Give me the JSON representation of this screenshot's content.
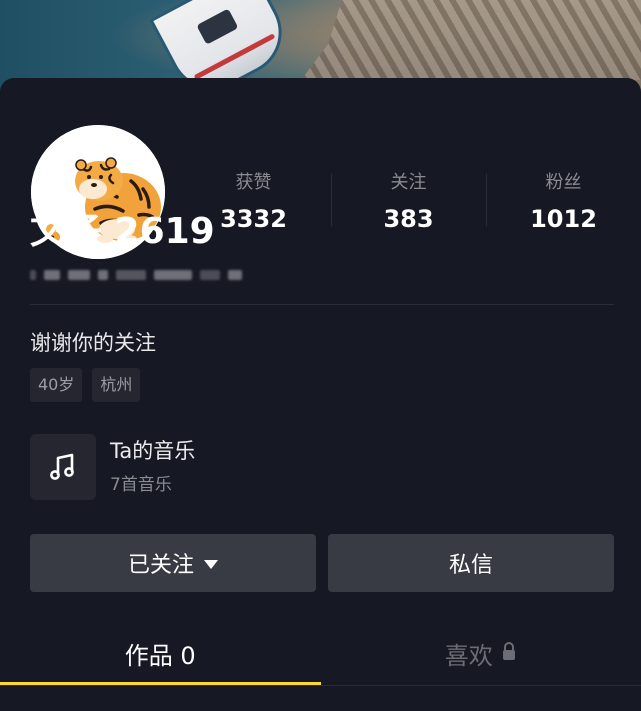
{
  "profile": {
    "username": "文子 2619",
    "bio": "谢谢你的关注",
    "tags": [
      "40岁",
      "杭州"
    ]
  },
  "stats": [
    {
      "label": "获赞",
      "value": "3332"
    },
    {
      "label": "关注",
      "value": "383"
    },
    {
      "label": "粉丝",
      "value": "1012"
    }
  ],
  "music": {
    "title": "Ta的音乐",
    "subtitle": "7首音乐",
    "icon": "music-note-icon"
  },
  "actions": {
    "follow_label": "已关注",
    "message_label": "私信"
  },
  "tabs": {
    "works_label": "作品 0",
    "likes_label": "喜欢"
  },
  "colors": {
    "background": "#161823",
    "button": "#393b44",
    "accent": "#fdd835",
    "muted_text": "#8a8b91"
  }
}
